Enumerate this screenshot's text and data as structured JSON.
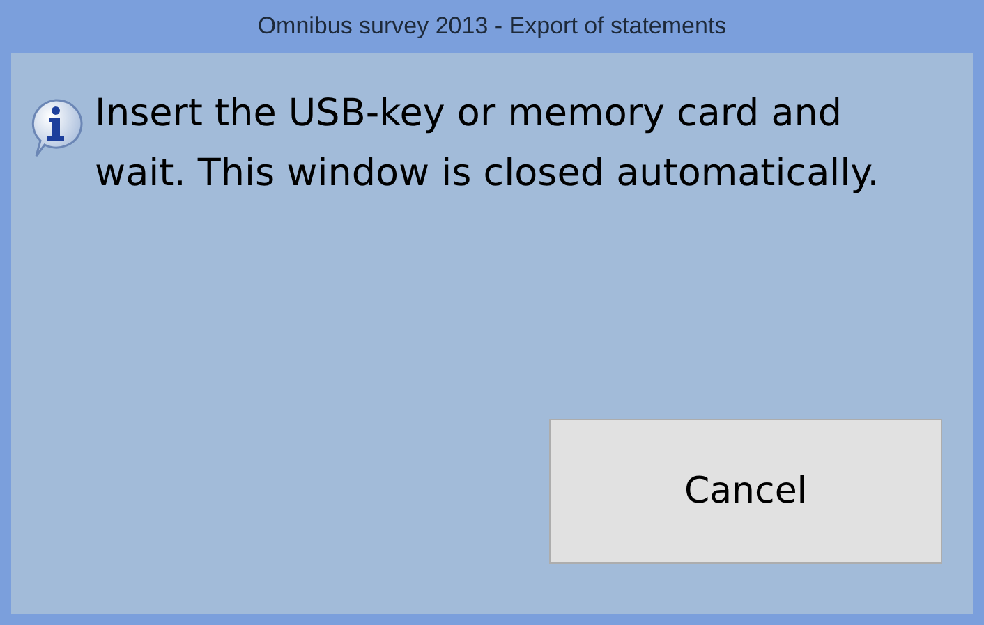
{
  "window": {
    "title": "Omnibus survey 2013 - Export of statements"
  },
  "message": {
    "text": "Insert the USB-key or memory card and wait. This window is closed automatically."
  },
  "buttons": [
    "Cancel"
  ]
}
